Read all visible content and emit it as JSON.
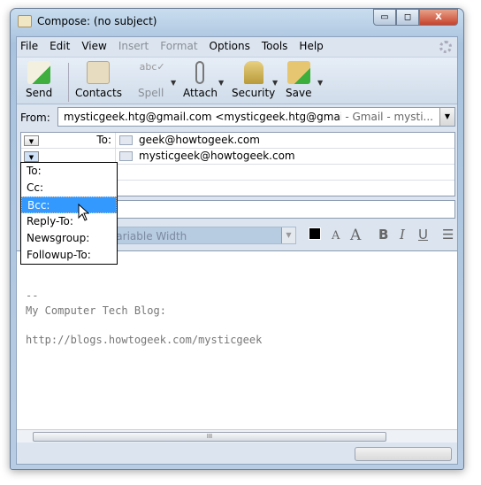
{
  "window": {
    "title": "Compose: (no subject)",
    "minimize": "▭",
    "maximize": "◻",
    "close": "X"
  },
  "menu": [
    {
      "label": "File"
    },
    {
      "label": "Edit"
    },
    {
      "label": "View"
    },
    {
      "label": "Insert",
      "disabled": true
    },
    {
      "label": "Format",
      "disabled": true
    },
    {
      "label": "Options"
    },
    {
      "label": "Tools"
    },
    {
      "label": "Help"
    }
  ],
  "toolbar": {
    "send": "Send",
    "contacts": "Contacts",
    "spell": "Spell",
    "attach": "Attach",
    "security": "Security",
    "save": "Save"
  },
  "from": {
    "label": "From:",
    "value": "mysticgeek.htg@gmail.com <mysticgeek.htg@gmail.co...",
    "account": "- Gmail - mysti..."
  },
  "recipients": [
    {
      "type": "To:",
      "address": "geek@howtogeek.com"
    },
    {
      "type": "",
      "address": "mysticgeek@howtogeek.com"
    }
  ],
  "type_menu": {
    "options": [
      "To:",
      "Cc:",
      "Bcc:",
      "Reply-To:",
      "Newsgroup:",
      "Followup-To:"
    ],
    "highlighted": "Bcc:"
  },
  "format": {
    "font": "Variable Width",
    "bold": "B",
    "italic": "I",
    "underline": "U",
    "smaller": "A",
    "larger": "A"
  },
  "body": {
    "text": "--\nMy Computer Tech Blog:\n\nhttp://blogs.howtogeek.com/mysticgeek"
  },
  "scrollbar": {
    "grip": "III"
  }
}
